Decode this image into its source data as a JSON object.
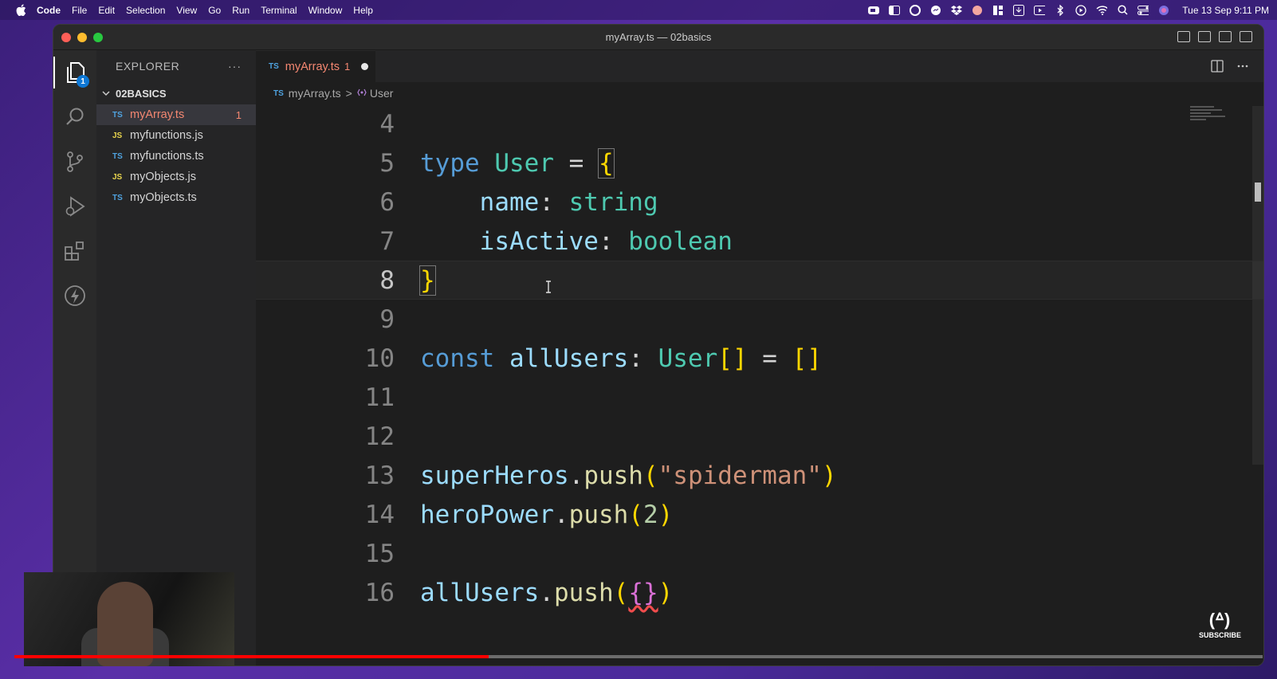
{
  "menubar": {
    "app": "Code",
    "menus": [
      "File",
      "Edit",
      "Selection",
      "View",
      "Go",
      "Run",
      "Terminal",
      "Window",
      "Help"
    ],
    "clock": "Tue 13 Sep  9:11 PM"
  },
  "window": {
    "title": "myArray.ts — 02basics"
  },
  "activity": {
    "explorer_badge": "1"
  },
  "explorer": {
    "header": "EXPLORER",
    "more": "···",
    "folder": "02BASICS",
    "files": [
      {
        "type": "TS",
        "name": "myArray.ts",
        "count": "1"
      },
      {
        "type": "JS",
        "name": "myfunctions.js"
      },
      {
        "type": "TS",
        "name": "myfunctions.ts"
      },
      {
        "type": "JS",
        "name": "myObjects.js"
      },
      {
        "type": "TS",
        "name": "myObjects.ts"
      }
    ]
  },
  "tab": {
    "type": "TS",
    "name": "myArray.ts",
    "count": "1"
  },
  "breadcrumb": {
    "type": "TS",
    "file": "myArray.ts",
    "sep": ">",
    "symbol": "User"
  },
  "code": {
    "line_numbers": [
      "4",
      "5",
      "6",
      "7",
      "8",
      "9",
      "10",
      "11",
      "12",
      "13",
      "14",
      "15",
      "16"
    ],
    "l5": {
      "kw": "type",
      "name": "User",
      "eq": " = ",
      "brace": "{"
    },
    "l6": {
      "prop": "name",
      "colon": ": ",
      "type": "string"
    },
    "l7": {
      "prop": "isActive",
      "colon": ": ",
      "type": "boolean"
    },
    "l8": {
      "brace": "}"
    },
    "l10": {
      "kw": "const",
      "name": "allUsers",
      "colon": ": ",
      "type": "User",
      "arr": "[]",
      "eq": " = ",
      "val": "[]"
    },
    "l13": {
      "obj": "superHeros",
      "dot": ".",
      "fn": "push",
      "open": "(",
      "arg": "\"spiderman\"",
      "close": ")"
    },
    "l14": {
      "obj": "heroPower",
      "dot": ".",
      "fn": "push",
      "open": "(",
      "arg": "2",
      "close": ")"
    },
    "l16": {
      "obj": "allUsers",
      "dot": ".",
      "fn": "push",
      "open": "(",
      "arg": "{}",
      "close": ")"
    }
  },
  "video": {
    "progress": 0.38,
    "subscribe": "SUBSCRIBE",
    "flame": "(ᐞ)"
  },
  "colors": {
    "accent": "#0e78d5",
    "error": "#f48771",
    "progress": "#ff0000"
  }
}
